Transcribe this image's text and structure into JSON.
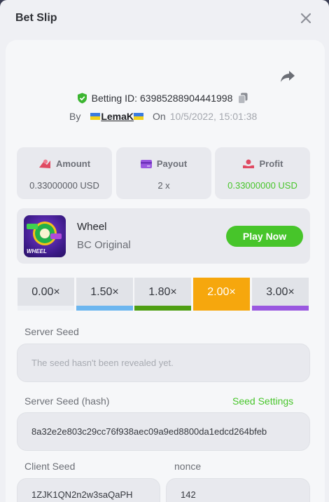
{
  "header": {
    "title": "Bet Slip"
  },
  "bet": {
    "betting_id_label": "Betting ID:",
    "betting_id": "639852889044419​98",
    "by_label": "By",
    "username": "LemaK",
    "on_label": "On",
    "datetime": "10/5/2022, 15:01:38"
  },
  "stats": {
    "amount": {
      "label": "Amount",
      "value": "0.33000000 USD"
    },
    "payout": {
      "label": "Payout",
      "value": "2 x"
    },
    "profit": {
      "label": "Profit",
      "value": "0.33000000 USD",
      "color": "#47c52a"
    }
  },
  "game": {
    "name": "Wheel",
    "provider": "BC Original",
    "thumb_text": "WHEEL",
    "play_label": "Play Now"
  },
  "multipliers": [
    {
      "label": "0.00×",
      "color": "#eef0f4"
    },
    {
      "label": "1.50×",
      "color": "#6cb6ef"
    },
    {
      "label": "1.80×",
      "color": "#4e9e12"
    },
    {
      "label": "2.00×",
      "color": "#f6a70d",
      "selected": true
    },
    {
      "label": "3.00×",
      "color": "#9a58e0"
    }
  ],
  "seeds": {
    "server_seed_label": "Server Seed",
    "server_seed_placeholder": "The seed hasn't been revealed yet.",
    "server_hash_label": "Server Seed (hash)",
    "seed_settings_label": "Seed Settings",
    "server_hash": "8a32e2e803c29cc76f938aec09a9ed8800da1edcd264bfeb",
    "client_seed_label": "Client Seed",
    "client_seed": "1ZJK1QN2n2w3saQaPH",
    "nonce_label": "nonce",
    "nonce": "142"
  }
}
